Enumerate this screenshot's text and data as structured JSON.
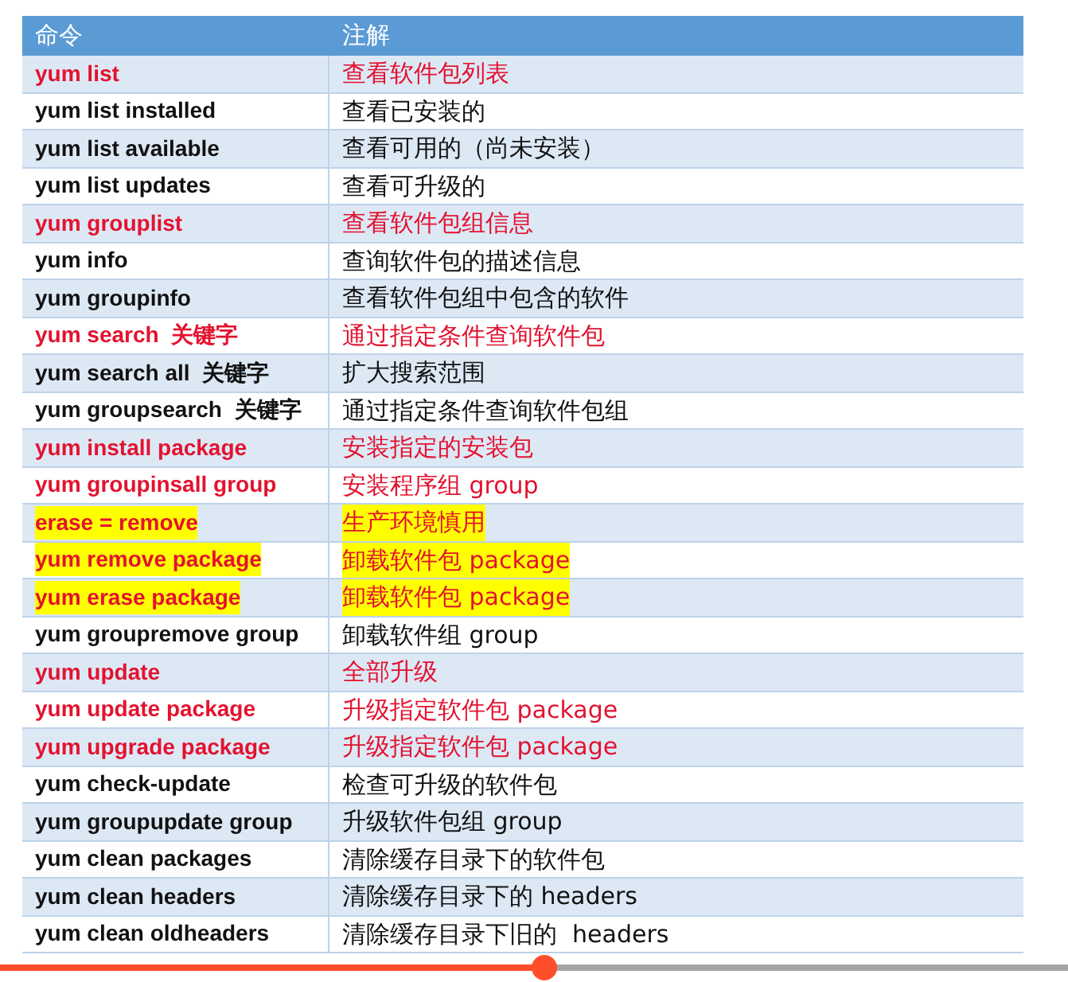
{
  "table": {
    "columns": [
      "命令",
      "注解"
    ],
    "rows": [
      {
        "command": "yum list",
        "note": "查看软件包列表",
        "red": true,
        "highlighted": false
      },
      {
        "command": "yum list installed",
        "note": "查看已安装的",
        "red": false,
        "highlighted": false
      },
      {
        "command": "yum list available",
        "note": "查看可用的（尚未安装）",
        "red": false,
        "highlighted": false
      },
      {
        "command": "yum list updates",
        "note": "查看可升级的",
        "red": false,
        "highlighted": false
      },
      {
        "command": "yum grouplist",
        "note": "查看软件包组信息",
        "red": true,
        "highlighted": false
      },
      {
        "command": "yum info",
        "note": "查询软件包的描述信息",
        "red": false,
        "highlighted": false
      },
      {
        "command": "yum groupinfo",
        "note": "查看软件包组中包含的软件",
        "red": false,
        "highlighted": false
      },
      {
        "command": "yum search  关键字",
        "note": "通过指定条件查询软件包",
        "red": true,
        "highlighted": false
      },
      {
        "command": "yum search all  关键字",
        "note": "扩大搜索范围",
        "red": false,
        "highlighted": false
      },
      {
        "command": "yum groupsearch  关键字",
        "note": "通过指定条件查询软件包组",
        "red": false,
        "highlighted": false
      },
      {
        "command": "yum install package",
        "note": "安装指定的安装包",
        "red": true,
        "highlighted": false
      },
      {
        "command": "yum groupinsall group",
        "note": "安装程序组 group",
        "red": true,
        "highlighted": false
      },
      {
        "command": "erase = remove",
        "note": "生产环境慎用",
        "red": true,
        "highlighted": true
      },
      {
        "command": "yum remove package",
        "note": "卸载软件包 package",
        "red": true,
        "highlighted": true
      },
      {
        "command": "yum erase package",
        "note": "卸载软件包 package",
        "red": true,
        "highlighted": true
      },
      {
        "command": "yum groupremove group",
        "note": "卸载软件组 group",
        "red": false,
        "highlighted": false
      },
      {
        "command": "yum update",
        "note": "全部升级",
        "red": true,
        "highlighted": false
      },
      {
        "command": "yum update package",
        "note": "升级指定软件包 package",
        "red": true,
        "highlighted": false
      },
      {
        "command": "yum upgrade package",
        "note": "升级指定软件包 package",
        "red": true,
        "highlighted": false
      },
      {
        "command": "yum check-update",
        "note": "检查可升级的软件包",
        "red": false,
        "highlighted": false
      },
      {
        "command": "yum groupupdate group",
        "note": "升级软件包组 group",
        "red": false,
        "highlighted": false
      },
      {
        "command": "yum clean packages",
        "note": "清除缓存目录下的软件包",
        "red": false,
        "highlighted": false
      },
      {
        "command": "yum clean headers",
        "note": "清除缓存目录下的 headers",
        "red": false,
        "highlighted": false
      },
      {
        "command": "yum clean oldheaders",
        "note": "清除缓存目录下旧的  headers",
        "red": false,
        "highlighted": false
      }
    ]
  },
  "player": {
    "level": 0.51
  }
}
